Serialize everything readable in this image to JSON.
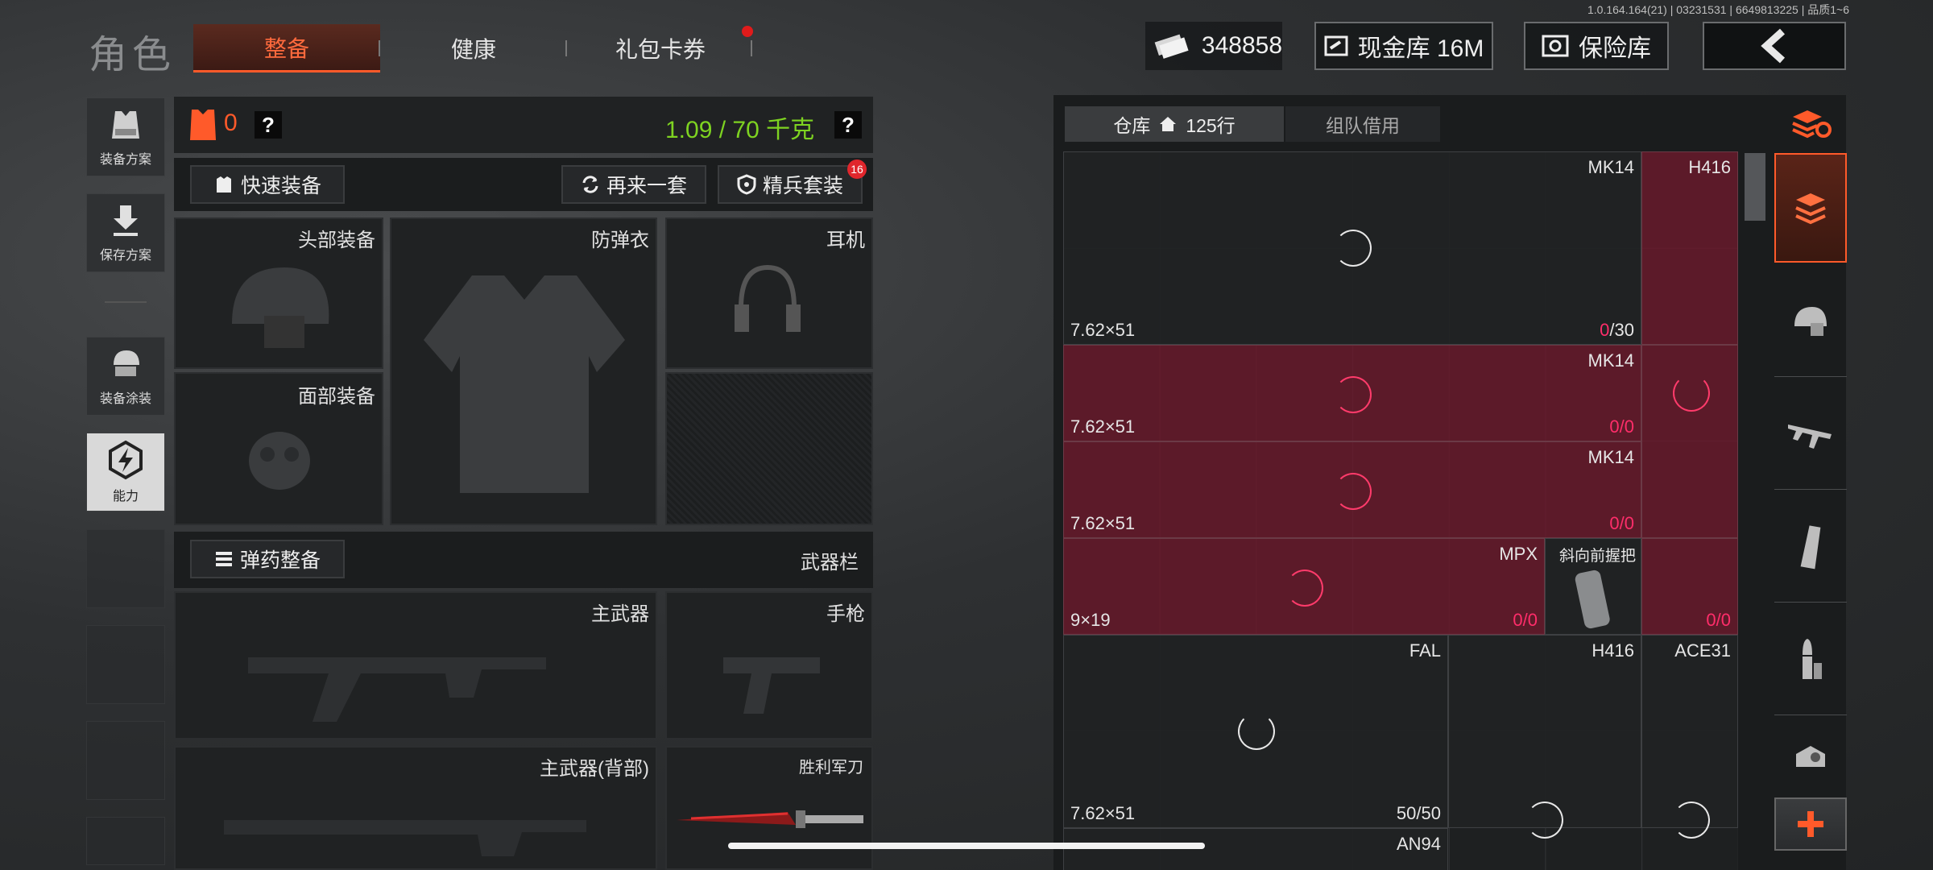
{
  "version": "1.0.164.164(21) | 03231531 | 6649813225 | 品质1~6",
  "header": {
    "title": "角色",
    "tabs": [
      {
        "label": "整备",
        "active": true
      },
      {
        "label": "健康",
        "active": false
      },
      {
        "label": "礼包卡券",
        "active": false
      }
    ],
    "currency": "348858",
    "cash_vault": "现金库 16M",
    "safe": "保险库",
    "back_icon": "chevron-left-icon"
  },
  "sidebar": {
    "items": [
      {
        "label": "装备方案",
        "icon": "vest-icon"
      },
      {
        "label": "保存方案",
        "icon": "download-icon"
      },
      {
        "label": "装备涂装",
        "icon": "helmet-paint-icon"
      },
      {
        "label": "能力",
        "icon": "ability-icon"
      }
    ]
  },
  "equip": {
    "armor_count": "0",
    "weight": "1.09 / 70 千克",
    "help": "?",
    "quick_equip": "快速装备",
    "again": "再来一套",
    "elite": "精兵套装",
    "elite_badge": "16",
    "slots": {
      "head": "头部装备",
      "vest": "防弹衣",
      "earphone": "耳机",
      "face": "面部装备"
    },
    "ammo_btn": "弹药整备",
    "weapon_bar": "武器栏",
    "weapons": {
      "primary": "主武器",
      "pistol": "手枪",
      "primary_back": "主武器(背部)",
      "knife": "胜利军刀"
    }
  },
  "storage": {
    "tab_warehouse": "仓库",
    "rows": "125行",
    "tab_team": "组队借用",
    "items": [
      {
        "name": "MK14",
        "cal": "7.62×51",
        "cur": "0",
        "max": "/30"
      },
      {
        "name": "H416",
        "cal": "",
        "cur": "",
        "max": ""
      },
      {
        "name": "MK14",
        "cal": "7.62×51",
        "cur": "0",
        "max": "/0"
      },
      {
        "name": "MK14",
        "cal": "7.62×51",
        "cur": "0",
        "max": "/0"
      },
      {
        "name": "MPX",
        "cal": "9×19",
        "cur": "0",
        "max": "/0"
      },
      {
        "name": "斜向前握把",
        "cal": "",
        "cur": "",
        "max": ""
      },
      {
        "name": "",
        "cal": "",
        "cur": "0",
        "max": "/0"
      },
      {
        "name": "FAL",
        "cal": "7.62×51",
        "cur": "50",
        "max": "/50"
      },
      {
        "name": "H416",
        "cal": "",
        "cur": "",
        "max": ""
      },
      {
        "name": "ACE31",
        "cal": "",
        "cur": "",
        "max": ""
      },
      {
        "name": "AN94",
        "cal": "",
        "cur": "",
        "max": ""
      }
    ]
  },
  "right_tabs": [
    "stack-refresh-icon",
    "stack-icon",
    "helmet-icon",
    "rifle-icon",
    "magazine-icon",
    "bullet-icon",
    "scope-icon",
    "plus-icon"
  ],
  "colors": {
    "accent": "#ff5a2a",
    "weight_green": "#7ed321",
    "ammo_pink": "#ff2d6a",
    "red_cell": "#6e182c"
  }
}
